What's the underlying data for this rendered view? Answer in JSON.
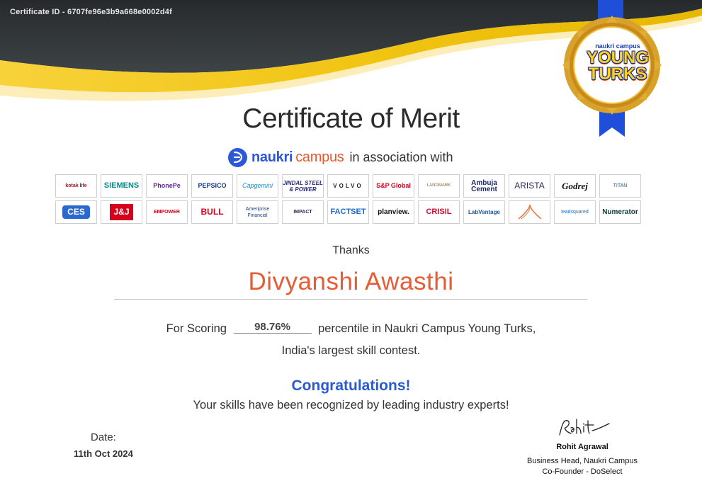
{
  "certificate": {
    "id_text": "Certificate ID - 6707fe96e3b9a668e0002d4f",
    "title": "Certificate of Merit",
    "recipient_name": "Divyanshi Awasthi",
    "percentile": "98.76%",
    "date": "11th Oct 2024"
  },
  "association": {
    "brand_naukri": "naukri",
    "brand_campus": "campus",
    "in_association_with": "in association with"
  },
  "medal": {
    "brand": "naukri campus",
    "title_line1": "YOUNG",
    "title_line2": "TURKS"
  },
  "sponsors": {
    "row1": [
      "kotak life",
      "SIEMENS",
      "PhonePe",
      "PEPSICO",
      "Capgemini",
      "JINDAL STEEL & POWER",
      "VOLVO",
      "S&P Global",
      "LANDMARK",
      "Ambuja Cement",
      "ARISTA",
      "Godrej",
      "TITAN"
    ],
    "row2": [
      "CES",
      "J&J",
      "EMPOWER",
      "BULL",
      "Ameriprise Financial",
      "IMPACT",
      "FACTSET",
      "planview.",
      "CRISIL",
      "LabVantage",
      "",
      "leadsquared",
      "Numerator"
    ]
  },
  "body": {
    "thanks": "Thanks",
    "for_scoring": "For Scoring",
    "percentile_suffix": "percentile in Naukri Campus Young Turks,",
    "contest_desc": "India's largest skill contest.",
    "congratulations": "Congratulations!",
    "recognized": "Your skills have been recognized by leading industry experts!",
    "date_label": "Date:"
  },
  "signatory": {
    "signature_text": "Rohit",
    "name": "Rohit Agrawal",
    "role1": "Business Head, Naukri Campus",
    "role2": "Co-Founder - DoSelect"
  },
  "colors": {
    "header_dark": "#2f3336",
    "gold": "#f2c514",
    "name_orange": "#e55d34",
    "congrats_blue": "#2a5ad0",
    "ribbon_blue": "#1f4fd8"
  }
}
